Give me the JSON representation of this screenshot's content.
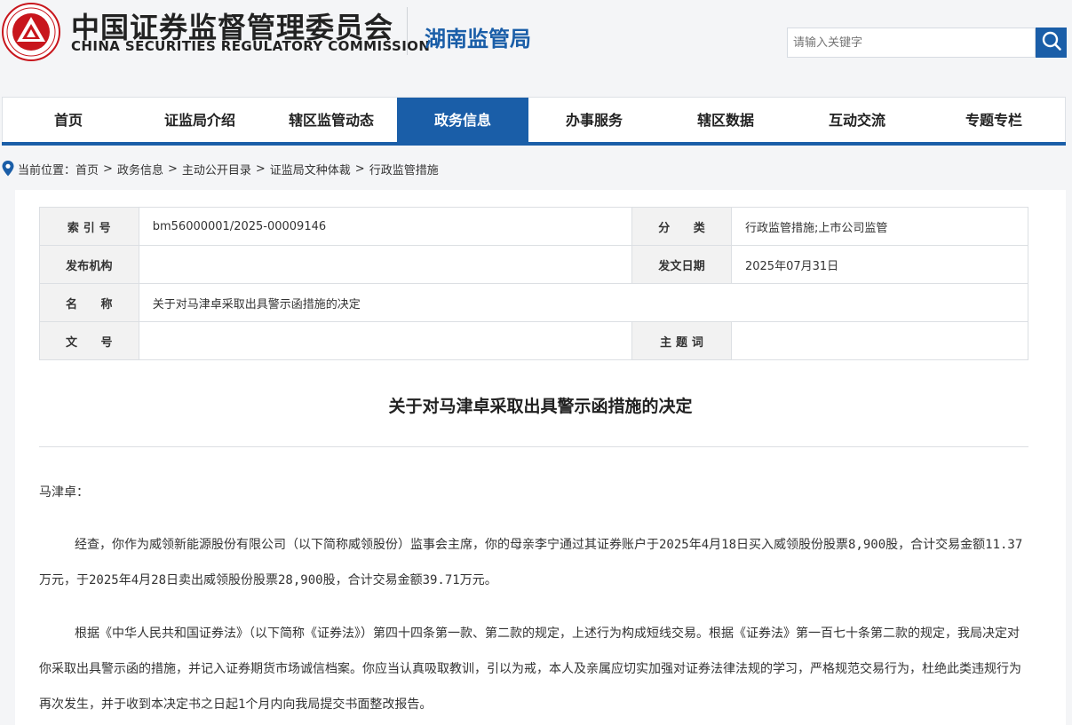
{
  "header": {
    "logo_text": "中国证券监督管理委员会",
    "org_cn": "中国证券监督管理委员会",
    "org_en": "CHINA SECURITIES REGULATORY COMMISSION",
    "bureau": "湖南监管局",
    "search_placeholder": "请输入关键字"
  },
  "nav": {
    "items": [
      {
        "label": "首页"
      },
      {
        "label": "证监局介绍"
      },
      {
        "label": "辖区监管动态"
      },
      {
        "label": "政务信息"
      },
      {
        "label": "办事服务"
      },
      {
        "label": "辖区数据"
      },
      {
        "label": "互动交流"
      },
      {
        "label": "专题专栏"
      }
    ],
    "active": "政务信息"
  },
  "breadcrumb": {
    "prefix": "当前位置：",
    "items": [
      "首页",
      "政务信息",
      "主动公开目录",
      "证监局文种体裁",
      "行政监管措施"
    ],
    "separator": ">"
  },
  "meta": {
    "index_label": "索 引 号",
    "index_value": "bm56000001/2025-00009146",
    "category_label": "分　　类",
    "category_value": "行政监管措施;上市公司监管",
    "publisher_label": "发布机构",
    "publisher_value": "",
    "date_label": "发文日期",
    "date_value": "2025年07月31日",
    "name_label": "名　　称",
    "name_value": "关于对马津卓采取出具警示函措施的决定",
    "docno_label": "文　　号",
    "docno_value": "",
    "subject_label": "主 题 词",
    "subject_value": ""
  },
  "document": {
    "title": "关于对马津卓采取出具警示函措施的决定",
    "salutation": "马津卓：",
    "paragraphs": [
      "经查，你作为威领新能源股份有限公司（以下简称威领股份）监事会主席，你的母亲李宁通过其证券账户于2025年4月18日买入威领股份股票8,900股，合计交易金额11.37万元，于2025年4月28日卖出威领股份股票28,900股，合计交易金额39.71万元。",
      "根据《中华人民共和国证券法》（以下简称《证券法》）第四十四条第一款、第二款的规定，上述行为构成短线交易。根据《证券法》第一百七十条第二款的规定，我局决定对你采取出具警示函的措施，并记入证券期货市场诚信档案。你应当认真吸取教训，引以为戒，本人及亲属应切实加强对证券法律法规的学习，严格规范交易行为，杜绝此类违规行为再次发生，并于收到本决定书之日起1个月内向我局提交书面整改报告。"
    ]
  },
  "colors": {
    "brand_blue": "#1a5ea8",
    "logo_red": "#c8161d",
    "page_bg": "#f4f5f7"
  },
  "icons": {
    "logo": "csrc-emblem-icon",
    "search": "search-icon",
    "location": "location-pin-icon"
  }
}
